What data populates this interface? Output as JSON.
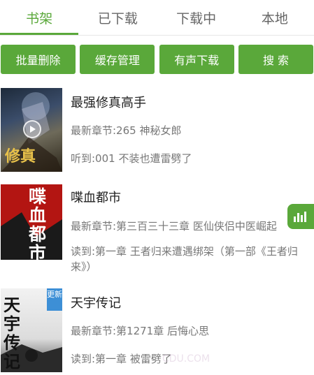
{
  "tabs": [
    {
      "label": "书架",
      "active": true
    },
    {
      "label": "已下载",
      "active": false
    },
    {
      "label": "下载中",
      "active": false
    },
    {
      "label": "本地",
      "active": false
    }
  ],
  "toolbar": {
    "batch_delete": "批量删除",
    "cache_manage": "缓存管理",
    "audio_download": "有声下载",
    "search": "搜 索"
  },
  "books": [
    {
      "title": "最强修真高手",
      "latest": "最新章节:265 神秘女郎",
      "progress": "听到:001 不装也遭雷劈了",
      "cover_text": "修真"
    },
    {
      "title": "喋血都市",
      "latest": "最新章节:第三百三十三章 医仙侠侣中医崛起",
      "progress": "读到:第一章 王者归来遭遇绑架（第一部《王者归来》）",
      "cover_text": "喋血都市"
    },
    {
      "title": "天宇传记",
      "latest": "最新章节:第1271章 后悔心思",
      "progress": "读到:第一章 被雷劈了",
      "cover_text": "天宇传记",
      "badge": "更新"
    }
  ],
  "watermark": "CDU.COM",
  "colors": {
    "accent": "#5aa83a"
  }
}
